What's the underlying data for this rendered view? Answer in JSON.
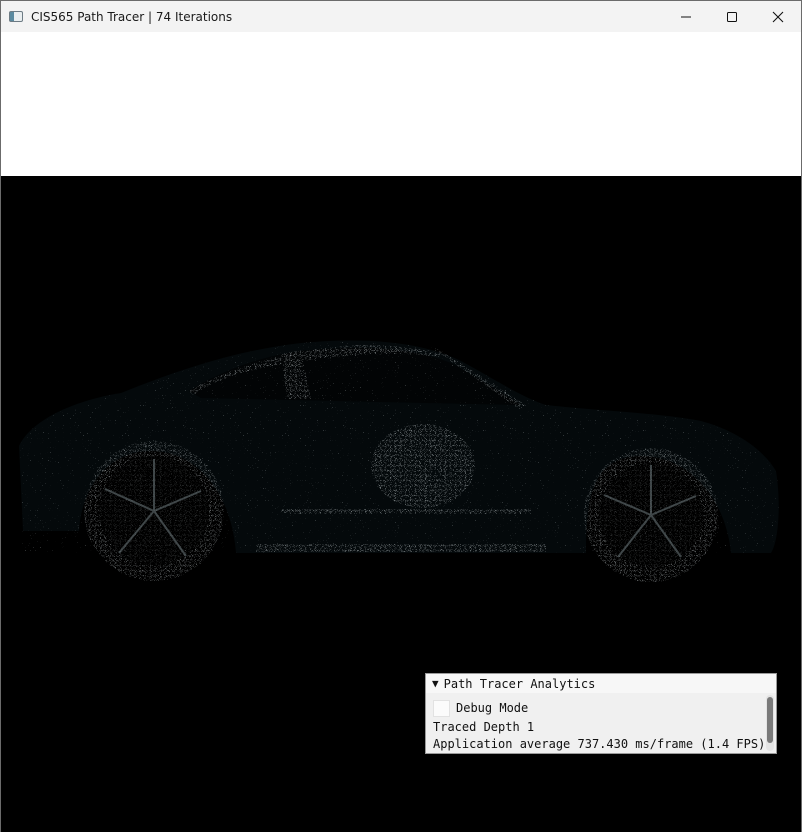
{
  "window": {
    "title": "CIS565 Path Tracer | 74 Iterations",
    "controls": [
      "minimize-icon",
      "maximize-icon",
      "close-icon"
    ]
  },
  "render": {
    "subject": "car-render",
    "background": "#000000",
    "noise_color": "#9fb0b4"
  },
  "analytics_panel": {
    "header": "Path Tracer Analytics",
    "collapse_icon": "triangle-down-icon",
    "debug_checkbox_label": "Debug Mode",
    "debug_checked": false,
    "traced_depth": "Traced Depth 1",
    "average_line": "Application average 737.430 ms/frame (1.4 FPS)"
  }
}
